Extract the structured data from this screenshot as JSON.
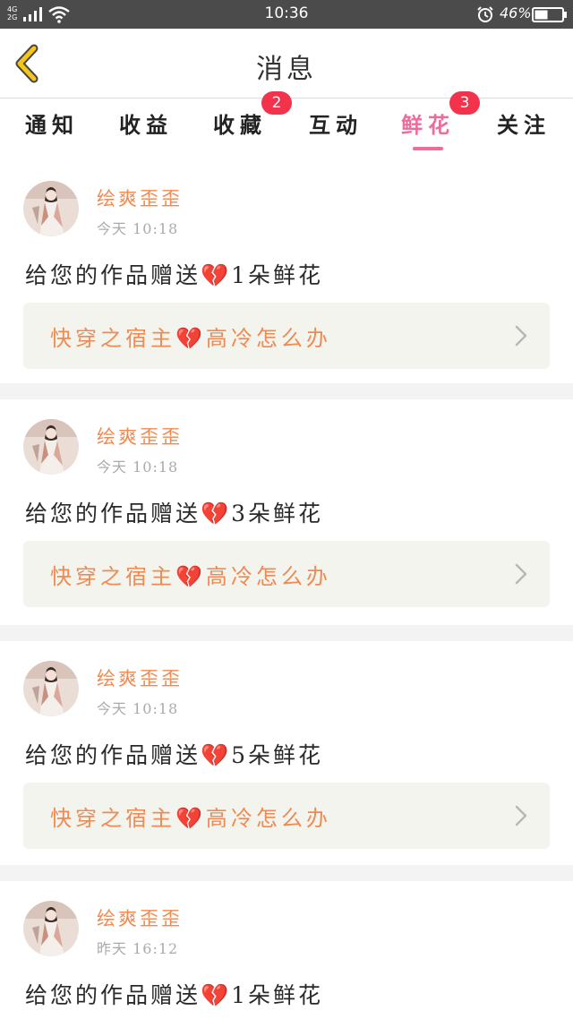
{
  "status_bar": {
    "network": "4G",
    "network2": "2G",
    "time": "10:36",
    "battery_percent": "46%"
  },
  "header": {
    "title": "消息",
    "back_icon": "chevron-left-icon",
    "back_color": "#f5c518"
  },
  "tabs": [
    {
      "label": "通知",
      "active": false
    },
    {
      "label": "收益",
      "active": false
    },
    {
      "label": "收藏",
      "active": false,
      "badge": "2"
    },
    {
      "label": "互动",
      "active": false
    },
    {
      "label": "鲜花",
      "active": true,
      "badge": "3"
    },
    {
      "label": "关注",
      "active": false
    }
  ],
  "colors": {
    "accent_pink": "#ee6b9c",
    "badge_red": "#f2334b",
    "name_orange": "#ef8a52"
  },
  "messages": [
    {
      "username": "绘爽歪歪",
      "time": "今天 10:18",
      "text": "给您的作品赠送💔1朵鲜花",
      "work_title": "快穿之宿主💔高冷怎么办"
    },
    {
      "username": "绘爽歪歪",
      "time": "今天 10:18",
      "text": "给您的作品赠送💔3朵鲜花",
      "work_title": "快穿之宿主💔高冷怎么办"
    },
    {
      "username": "绘爽歪歪",
      "time": "今天 10:18",
      "text": "给您的作品赠送💔5朵鲜花",
      "work_title": "快穿之宿主💔高冷怎么办"
    },
    {
      "username": "绘爽歪歪",
      "time": "昨天 16:12",
      "text": "给您的作品赠送💔1朵鲜花",
      "work_title": ""
    }
  ]
}
